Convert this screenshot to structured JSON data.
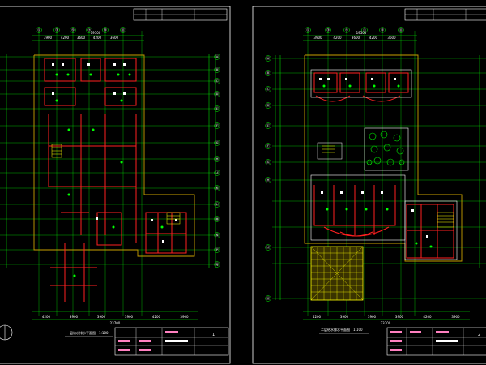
{
  "drawing": {
    "background_color": "#000000",
    "colors": {
      "frame": "#ffffff",
      "axis": "#00ff00",
      "wall": "#ff2020",
      "outline": "#c8a000",
      "hatch": "#ffff00",
      "tree": "#00ff00",
      "title_pink": "#ff80c0"
    },
    "sheets": [
      {
        "title_left": "一层给水排水平面图",
        "scale_left": "1:100",
        "col_axes": [
          "①",
          "③",
          "⑤",
          "⑦",
          "⑨",
          "⑪"
        ],
        "col_dims": [
          "3900",
          "4200",
          "3600",
          "4200",
          "3600"
        ],
        "overall_dim": "19500",
        "row_axes_right": [
          "Ⓐ",
          "Ⓑ",
          "Ⓒ",
          "Ⓓ",
          "Ⓔ",
          "Ⓕ",
          "Ⓖ",
          "Ⓗ",
          "Ⓙ",
          "Ⓚ",
          "Ⓛ",
          "Ⓜ",
          "Ⓝ",
          "Ⓟ",
          "Ⓠ"
        ],
        "bottom_dims": [
          "4200",
          "3900",
          "3900",
          "3900",
          "4200",
          "3900"
        ],
        "bottom_total": "23700",
        "sheet_number": "1"
      },
      {
        "title_left": "二层给水排水平面图",
        "scale_left": "1:100",
        "col_axes": [
          "①",
          "③",
          "⑤",
          "⑦",
          "⑨",
          "⑪"
        ],
        "col_dims": [
          "3900",
          "4200",
          "3600",
          "4200",
          "3600"
        ],
        "overall_dim": "19500",
        "row_axes_left": [
          "Ⓐ",
          "Ⓑ",
          "Ⓒ",
          "Ⓓ",
          "Ⓔ",
          "Ⓕ",
          "Ⓖ",
          "Ⓗ",
          "Ⓙ",
          "Ⓚ"
        ],
        "bottom_dims": [
          "4200",
          "3900",
          "3900",
          "3900",
          "4200",
          "3900"
        ],
        "bottom_total": "23700",
        "sheet_number": "2"
      }
    ]
  }
}
